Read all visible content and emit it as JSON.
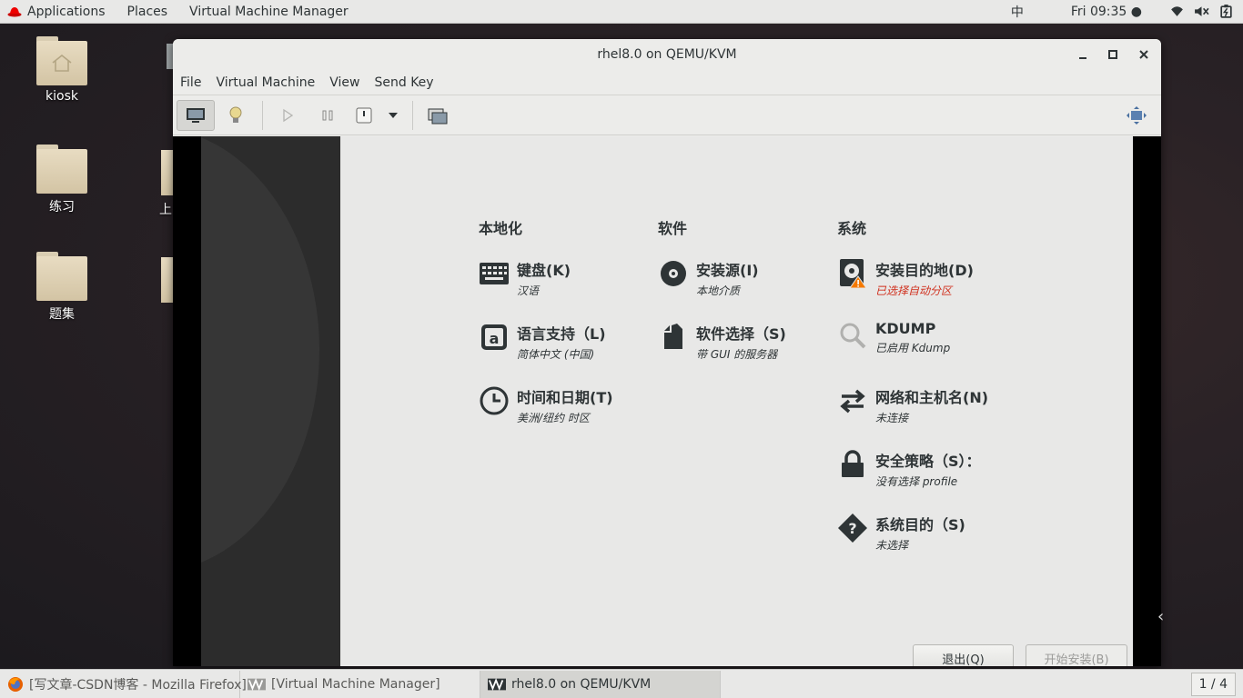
{
  "topbar": {
    "applications": "Applications",
    "places": "Places",
    "active_app": "Virtual Machine Manager",
    "input_method": "中",
    "clock": "Fri 09:35 ●"
  },
  "desktop": {
    "icons": [
      {
        "label": "kiosk"
      },
      {
        "label": "练习"
      },
      {
        "label": "题集"
      }
    ],
    "partial_labels": [
      "上",
      ""
    ]
  },
  "vm_window": {
    "title": "rhel8.0 on QEMU/KVM",
    "menu": [
      "File",
      "Virtual Machine",
      "View",
      "Send Key"
    ]
  },
  "installer": {
    "columns": {
      "localization": "本地化",
      "software": "软件",
      "system": "系统"
    },
    "spokes": {
      "keyboard": {
        "title": "键盘(K)",
        "status": "汉语"
      },
      "language": {
        "title": "语言支持（L)",
        "status": "简体中文 (中国)"
      },
      "time": {
        "title": "时间和日期(T)",
        "status": "美洲/纽约 时区"
      },
      "source": {
        "title": "安装源(I)",
        "status": "本地介质"
      },
      "software_sel": {
        "title": "软件选择（S)",
        "status": "带 GUI 的服务器"
      },
      "destination": {
        "title": "安装目的地(D)",
        "status": "已选择自动分区"
      },
      "kdump": {
        "title": "KDUMP",
        "status": "已启用 Kdump"
      },
      "network": {
        "title": "网络和主机名(N)",
        "status": "未连接"
      },
      "security": {
        "title": "安全策略（S）：",
        "status": "没有选择 profile"
      },
      "purpose": {
        "title": "系统目的（S)",
        "status": "未选择"
      }
    },
    "buttons": {
      "quit": "退出(Q)",
      "begin": "开始安装(B)"
    }
  },
  "taskbar": {
    "tasks": [
      "[写文章-CSDN博客 - Mozilla Firefox]",
      "[Virtual Machine Manager]",
      "rhel8.0 on QEMU/KVM"
    ],
    "pager": "1 / 4"
  },
  "colors": {
    "warning": "#d0301e",
    "panel": "#e8e8e7"
  }
}
